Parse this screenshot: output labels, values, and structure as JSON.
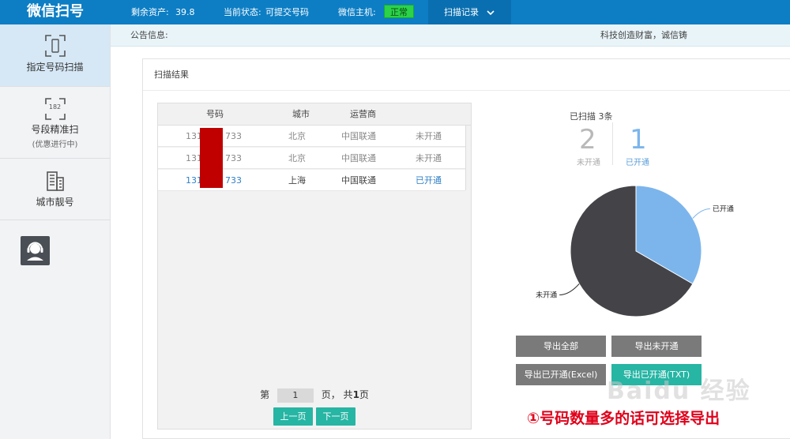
{
  "header": {
    "brand": "微信扫号",
    "assets_label": "剩余资产:",
    "assets_value": "39.8",
    "status_label": "当前状态:",
    "status_value": "可提交号码",
    "host_label": "微信主机:",
    "host_status": "正常",
    "menu_label": "扫描记录",
    "colors": {
      "bar": "#0d7ec4",
      "ok": "#2bd24a"
    }
  },
  "sidebar": {
    "items": [
      {
        "label": "指定号码扫描",
        "sub": "",
        "icon": "scan-frame-icon"
      },
      {
        "label": "号段精准扫",
        "sub": "(优惠进行中)",
        "icon_text": "182",
        "icon": "segment-scan-icon"
      },
      {
        "label": "城市靓号",
        "sub": "",
        "icon": "city-building-icon"
      }
    ],
    "support_icon": "customer-service-icon"
  },
  "notice": {
    "label": "公告信息:",
    "text": "科技创造财富，诚信铸"
  },
  "panel": {
    "title": "扫描结果",
    "table": {
      "headers": [
        "号码",
        "城市",
        "运营商"
      ],
      "rows": [
        {
          "num_start": "131",
          "num_end": "733",
          "city": "北京",
          "carrier": "中国联通",
          "status": "未开通"
        },
        {
          "num_start": "131",
          "num_end": "733",
          "city": "北京",
          "carrier": "中国联通",
          "status": "未开通"
        },
        {
          "num_start": "131",
          "num_end": "733",
          "city": "上海",
          "carrier": "中国联通",
          "status": "已开通"
        }
      ]
    },
    "pager": {
      "prefix": "第",
      "page": "1",
      "suffix": "页， 共",
      "total": "1",
      "unit": "页",
      "prev": "上一页",
      "next": "下一页"
    },
    "stats": {
      "title": "已扫描 3条",
      "not_open_count": "2",
      "not_open_label": "未开通",
      "open_count": "1",
      "open_label": "已开通"
    },
    "exports": {
      "all": "导出全部",
      "not_open": "导出未开通",
      "open_excel": "导出已开通(Excel)",
      "open_txt": "导出已开通(TXT)"
    }
  },
  "chart_data": {
    "type": "pie",
    "slices": [
      {
        "label": "已开通",
        "value": 1,
        "color": "#7cb5ec"
      },
      {
        "label": "未开通",
        "value": 2,
        "color": "#434348"
      }
    ]
  },
  "overlay": {
    "watermark": "Baidu 经验",
    "annotation": "①号码数量多的话可选择导出"
  }
}
